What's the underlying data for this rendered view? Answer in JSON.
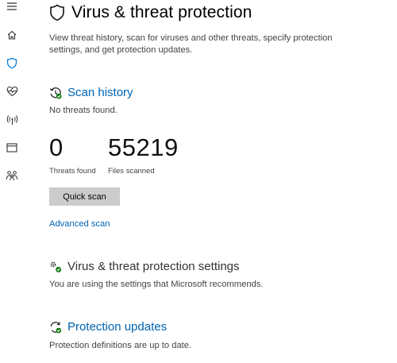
{
  "nav": {
    "items": [
      {
        "icon": "hamburger-menu-icon"
      },
      {
        "icon": "home-icon"
      },
      {
        "icon": "shield-icon",
        "selected": true
      },
      {
        "icon": "heart-pulse-icon"
      },
      {
        "icon": "wireless-antenna-icon"
      },
      {
        "icon": "browser-window-icon"
      },
      {
        "icon": "family-icon"
      }
    ]
  },
  "page": {
    "title": "Virus & threat protection",
    "description": "View threat history, scan for viruses and other threats, specify protection settings, and get protection updates."
  },
  "scan_history": {
    "title": "Scan history",
    "status": "No threats found.",
    "threats_found_value": "0",
    "threats_found_label": "Threats found",
    "files_scanned_value": "55219",
    "files_scanned_label": "Files scanned",
    "quick_scan_label": "Quick scan",
    "advanced_scan_label": "Advanced scan"
  },
  "settings": {
    "title": "Virus & threat protection settings",
    "status": "You are using the settings that Microsoft recommends."
  },
  "updates": {
    "title": "Protection updates",
    "status": "Protection definitions are up to date."
  },
  "colors": {
    "accent": "#0063b1",
    "ok_green": "#107c10",
    "button_bg": "#cccccc"
  }
}
